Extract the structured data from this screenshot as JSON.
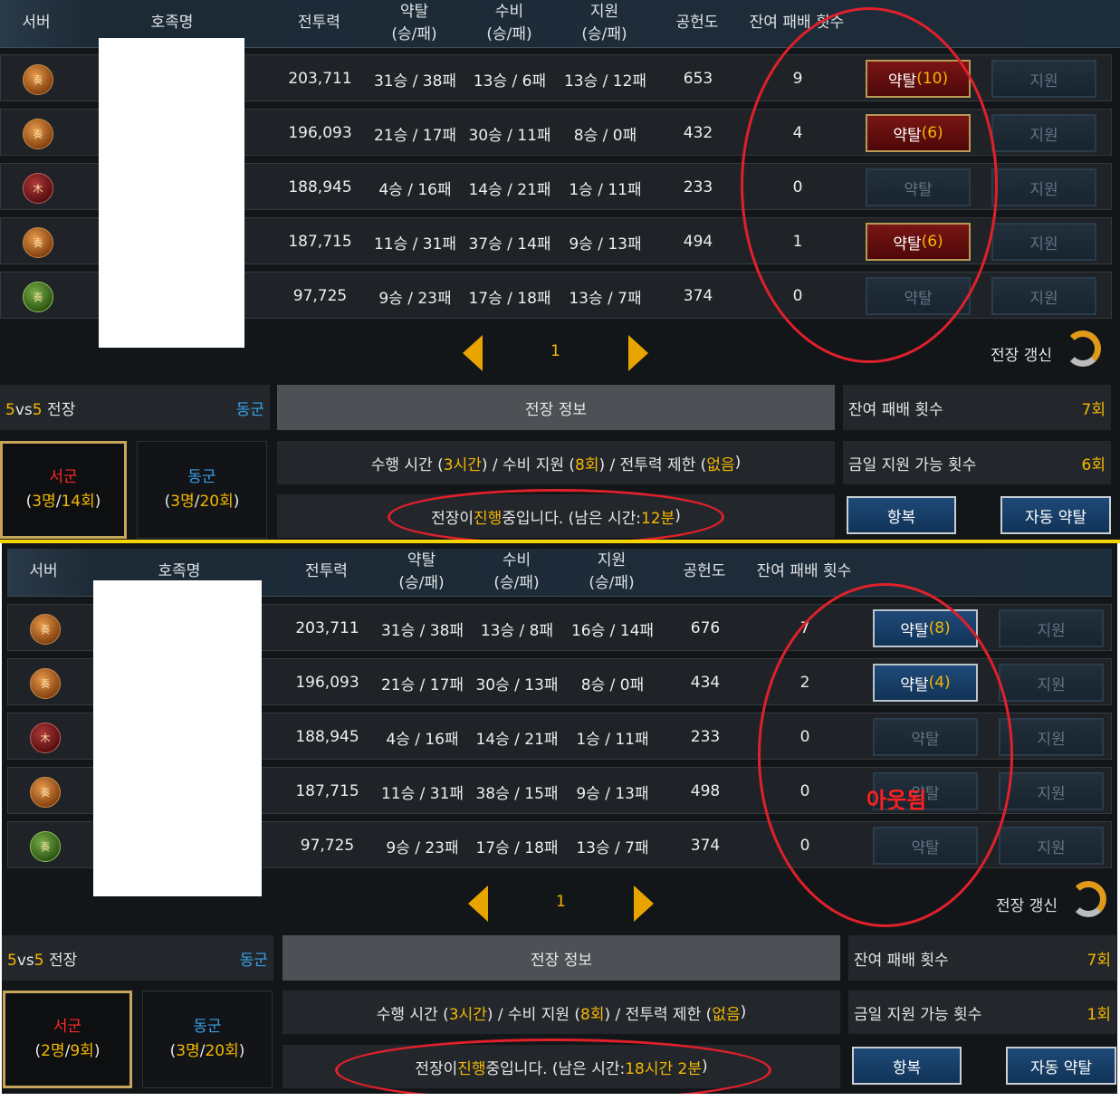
{
  "headers": {
    "server": "서버",
    "family": "호족명",
    "power": "전투력",
    "raid": "약탈",
    "raid_sub": "(승/패)",
    "defense": "수비",
    "defense_sub": "(승/패)",
    "support": "지원",
    "support_sub": "(승/패)",
    "contribution": "공헌도",
    "remaining": "잔여 패배 횟수"
  },
  "panel1": {
    "rows": [
      {
        "icon": "奏",
        "power": "203,711",
        "raid": "31승 / 38패",
        "defense": "13승 / 6패",
        "support": "13승 / 12패",
        "contribution": "653",
        "remaining": "9",
        "raid_btn": "약탈",
        "raid_count": "(10)",
        "support_btn": "지원"
      },
      {
        "icon": "奏",
        "power": "196,093",
        "raid": "21승 / 17패",
        "defense": "30승 / 11패",
        "support": "8승 / 0패",
        "contribution": "432",
        "remaining": "4",
        "raid_btn": "약탈",
        "raid_count": "(6)",
        "support_btn": "지원"
      },
      {
        "icon": "木",
        "power": "188,945",
        "raid": "4승 / 16패",
        "defense": "14승 / 21패",
        "support": "1승 / 11패",
        "contribution": "233",
        "remaining": "0",
        "raid_btn": "약탈",
        "raid_count": "",
        "support_btn": "지원"
      },
      {
        "icon": "奏",
        "power": "187,715",
        "raid": "11승 / 31패",
        "defense": "37승 / 14패",
        "support": "9승 / 13패",
        "contribution": "494",
        "remaining": "1",
        "raid_btn": "약탈",
        "raid_count": "(6)",
        "support_btn": "지원"
      },
      {
        "icon": "奏",
        "power": "97,725",
        "raid": "9승 / 23패",
        "defense": "17승 / 18패",
        "support": "13승 / 7패",
        "contribution": "374",
        "remaining": "0",
        "raid_btn": "약탈",
        "raid_count": "",
        "support_btn": "지원"
      }
    ],
    "page": "1",
    "refresh": "전장 갱신",
    "battle_type_pre": "5",
    "battle_type_vs": "vs",
    "battle_type_post": "5",
    "battle_label": " 전장",
    "side": "동군",
    "info_title": "전장 정보",
    "info_line1": {
      "a": "수행 시간 (",
      "b": "3시간",
      "c": ") / 수비 지원 (",
      "d": "8회",
      "e": ") / 전투력 제한 (",
      "f": "없음",
      "g": ")"
    },
    "info_line2": {
      "a": "전장이 ",
      "b": "진행",
      "c": "중입니다. (남은 시간: ",
      "d": "12분",
      "e": ")"
    },
    "team_west": {
      "name": "서군",
      "stats_a": "(",
      "stats_b": "3명",
      "stats_c": "/",
      "stats_d": "14회",
      "stats_e": ")"
    },
    "team_east": {
      "name": "동군",
      "stats_a": "(",
      "stats_b": "3명",
      "stats_c": "/",
      "stats_d": "20회",
      "stats_e": ")"
    },
    "remaining_losses_label": "잔여 패배 횟수",
    "remaining_losses_value": "7회",
    "support_today_label": "금일 지원 가능 횟수",
    "support_today_value": "6회",
    "surrender": "항복",
    "auto_raid": "자동 약탈"
  },
  "panel2": {
    "rows": [
      {
        "icon": "奏",
        "power": "203,711",
        "raid": "31승 / 38패",
        "defense": "13승 / 8패",
        "support": "16승 / 14패",
        "contribution": "676",
        "remaining": "7",
        "raid_btn": "약탈",
        "raid_count": "(8)",
        "support_btn": "지원"
      },
      {
        "icon": "奏",
        "power": "196,093",
        "raid": "21승 / 17패",
        "defense": "30승 / 13패",
        "support": "8승 / 0패",
        "contribution": "434",
        "remaining": "2",
        "raid_btn": "약탈",
        "raid_count": "(4)",
        "support_btn": "지원"
      },
      {
        "icon": "木",
        "power": "188,945",
        "raid": "4승 / 16패",
        "defense": "14승 / 21패",
        "support": "1승 / 11패",
        "contribution": "233",
        "remaining": "0",
        "raid_btn": "약탈",
        "raid_count": "",
        "support_btn": "지원"
      },
      {
        "icon": "奏",
        "power": "187,715",
        "raid": "11승 / 31패",
        "defense": "38승 / 15패",
        "support": "9승 / 13패",
        "contribution": "498",
        "remaining": "0",
        "raid_btn": "약탈",
        "raid_count": "",
        "support_btn": "지원"
      },
      {
        "icon": "奏",
        "power": "97,725",
        "raid": "9승 / 23패",
        "defense": "17승 / 18패",
        "support": "13승 / 7패",
        "contribution": "374",
        "remaining": "0",
        "raid_btn": "약탈",
        "raid_count": "",
        "support_btn": "지원"
      }
    ],
    "annotation_out": "아웃됨",
    "page": "1",
    "refresh": "전장 갱신",
    "battle_type_pre": "5",
    "battle_type_vs": "vs",
    "battle_type_post": "5",
    "battle_label": " 전장",
    "side": "동군",
    "info_title": "전장 정보",
    "info_line1": {
      "a": "수행 시간 (",
      "b": "3시간",
      "c": ") / 수비 지원 (",
      "d": "8회",
      "e": ") / 전투력 제한 (",
      "f": "없음",
      "g": ")"
    },
    "info_line2": {
      "a": "전장이 ",
      "b": "진행",
      "c": "중입니다. (남은 시간: ",
      "d": "18시간 2분",
      "e": ")"
    },
    "team_west": {
      "name": "서군",
      "stats_a": "(",
      "stats_b": "2명",
      "stats_c": "/",
      "stats_d": "9회",
      "stats_e": ")"
    },
    "team_east": {
      "name": "동군",
      "stats_a": "(",
      "stats_b": "3명",
      "stats_c": "/",
      "stats_d": "20회",
      "stats_e": ")"
    },
    "remaining_losses_label": "잔여 패배 횟수",
    "remaining_losses_value": "7회",
    "support_today_label": "금일 지원 가능 횟수",
    "support_today_value": "1회",
    "surrender": "항복",
    "auto_raid": "자동 약탈"
  },
  "colors": {
    "accent_gold": "#f5b800",
    "west_red": "#ff2a2a",
    "east_blue": "#3aa0e6",
    "annotation_red": "#e0202a"
  }
}
